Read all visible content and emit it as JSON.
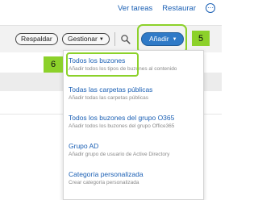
{
  "top_links": {
    "view_tasks": "Ver tareas",
    "restore": "Restaurar",
    "more_icon": "more-horizontal-icon"
  },
  "toolbar": {
    "backup_label": "Respaldar",
    "manage_label": "Gestionar",
    "add_label": "Añadir",
    "search_icon": "search-icon",
    "accent_color": "#2f7ac7"
  },
  "callouts": {
    "add_step": "5",
    "menu_step": "6",
    "highlight_color": "#8cd12a"
  },
  "add_menu": {
    "items": [
      {
        "label": "Todos los buzones",
        "description": "Añadir todos los tipos de buzones al contenido"
      },
      {
        "label": "Todas las carpetas públicas",
        "description": "Añadir todas las carpetas públicas"
      },
      {
        "label": "Todos los buzones del grupo O365",
        "description": "Añadir todos los buzones del grupo Office365"
      },
      {
        "label": "Grupo AD",
        "description": "Añadir grupo de usuario de Active Directory"
      },
      {
        "label": "Categoría personalizada",
        "description": "Crear categoría personalizada"
      }
    ]
  }
}
